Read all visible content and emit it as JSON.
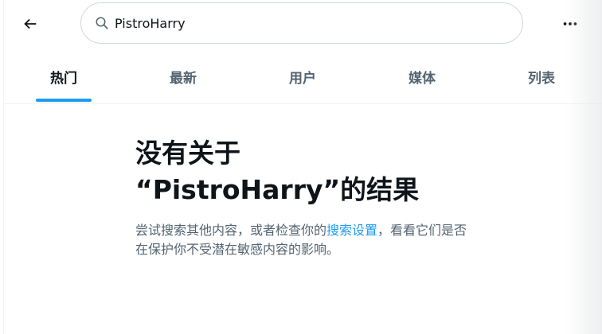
{
  "search": {
    "query": "PistroHarry"
  },
  "tabs": [
    {
      "label": "热门",
      "active": true
    },
    {
      "label": "最新",
      "active": false
    },
    {
      "label": "用户",
      "active": false
    },
    {
      "label": "媒体",
      "active": false
    },
    {
      "label": "列表",
      "active": false
    }
  ],
  "empty_state": {
    "title_line1": "没有关于",
    "title_line2": "“PistroHarry”的结果",
    "body_before_link": "尝试搜索其他内容，或者检查你的",
    "link_text": "搜索设置",
    "body_after_link": "，看看它们是否在保护你不受潜在敏感内容的影响。"
  },
  "icons": {
    "back": "arrow-left-icon",
    "search": "search-icon",
    "more": "more-horizontal-icon"
  },
  "colors": {
    "accent": "#1d9bf0",
    "text_primary": "#0f1419",
    "text_secondary": "#536471",
    "border": "#cfd9de"
  }
}
